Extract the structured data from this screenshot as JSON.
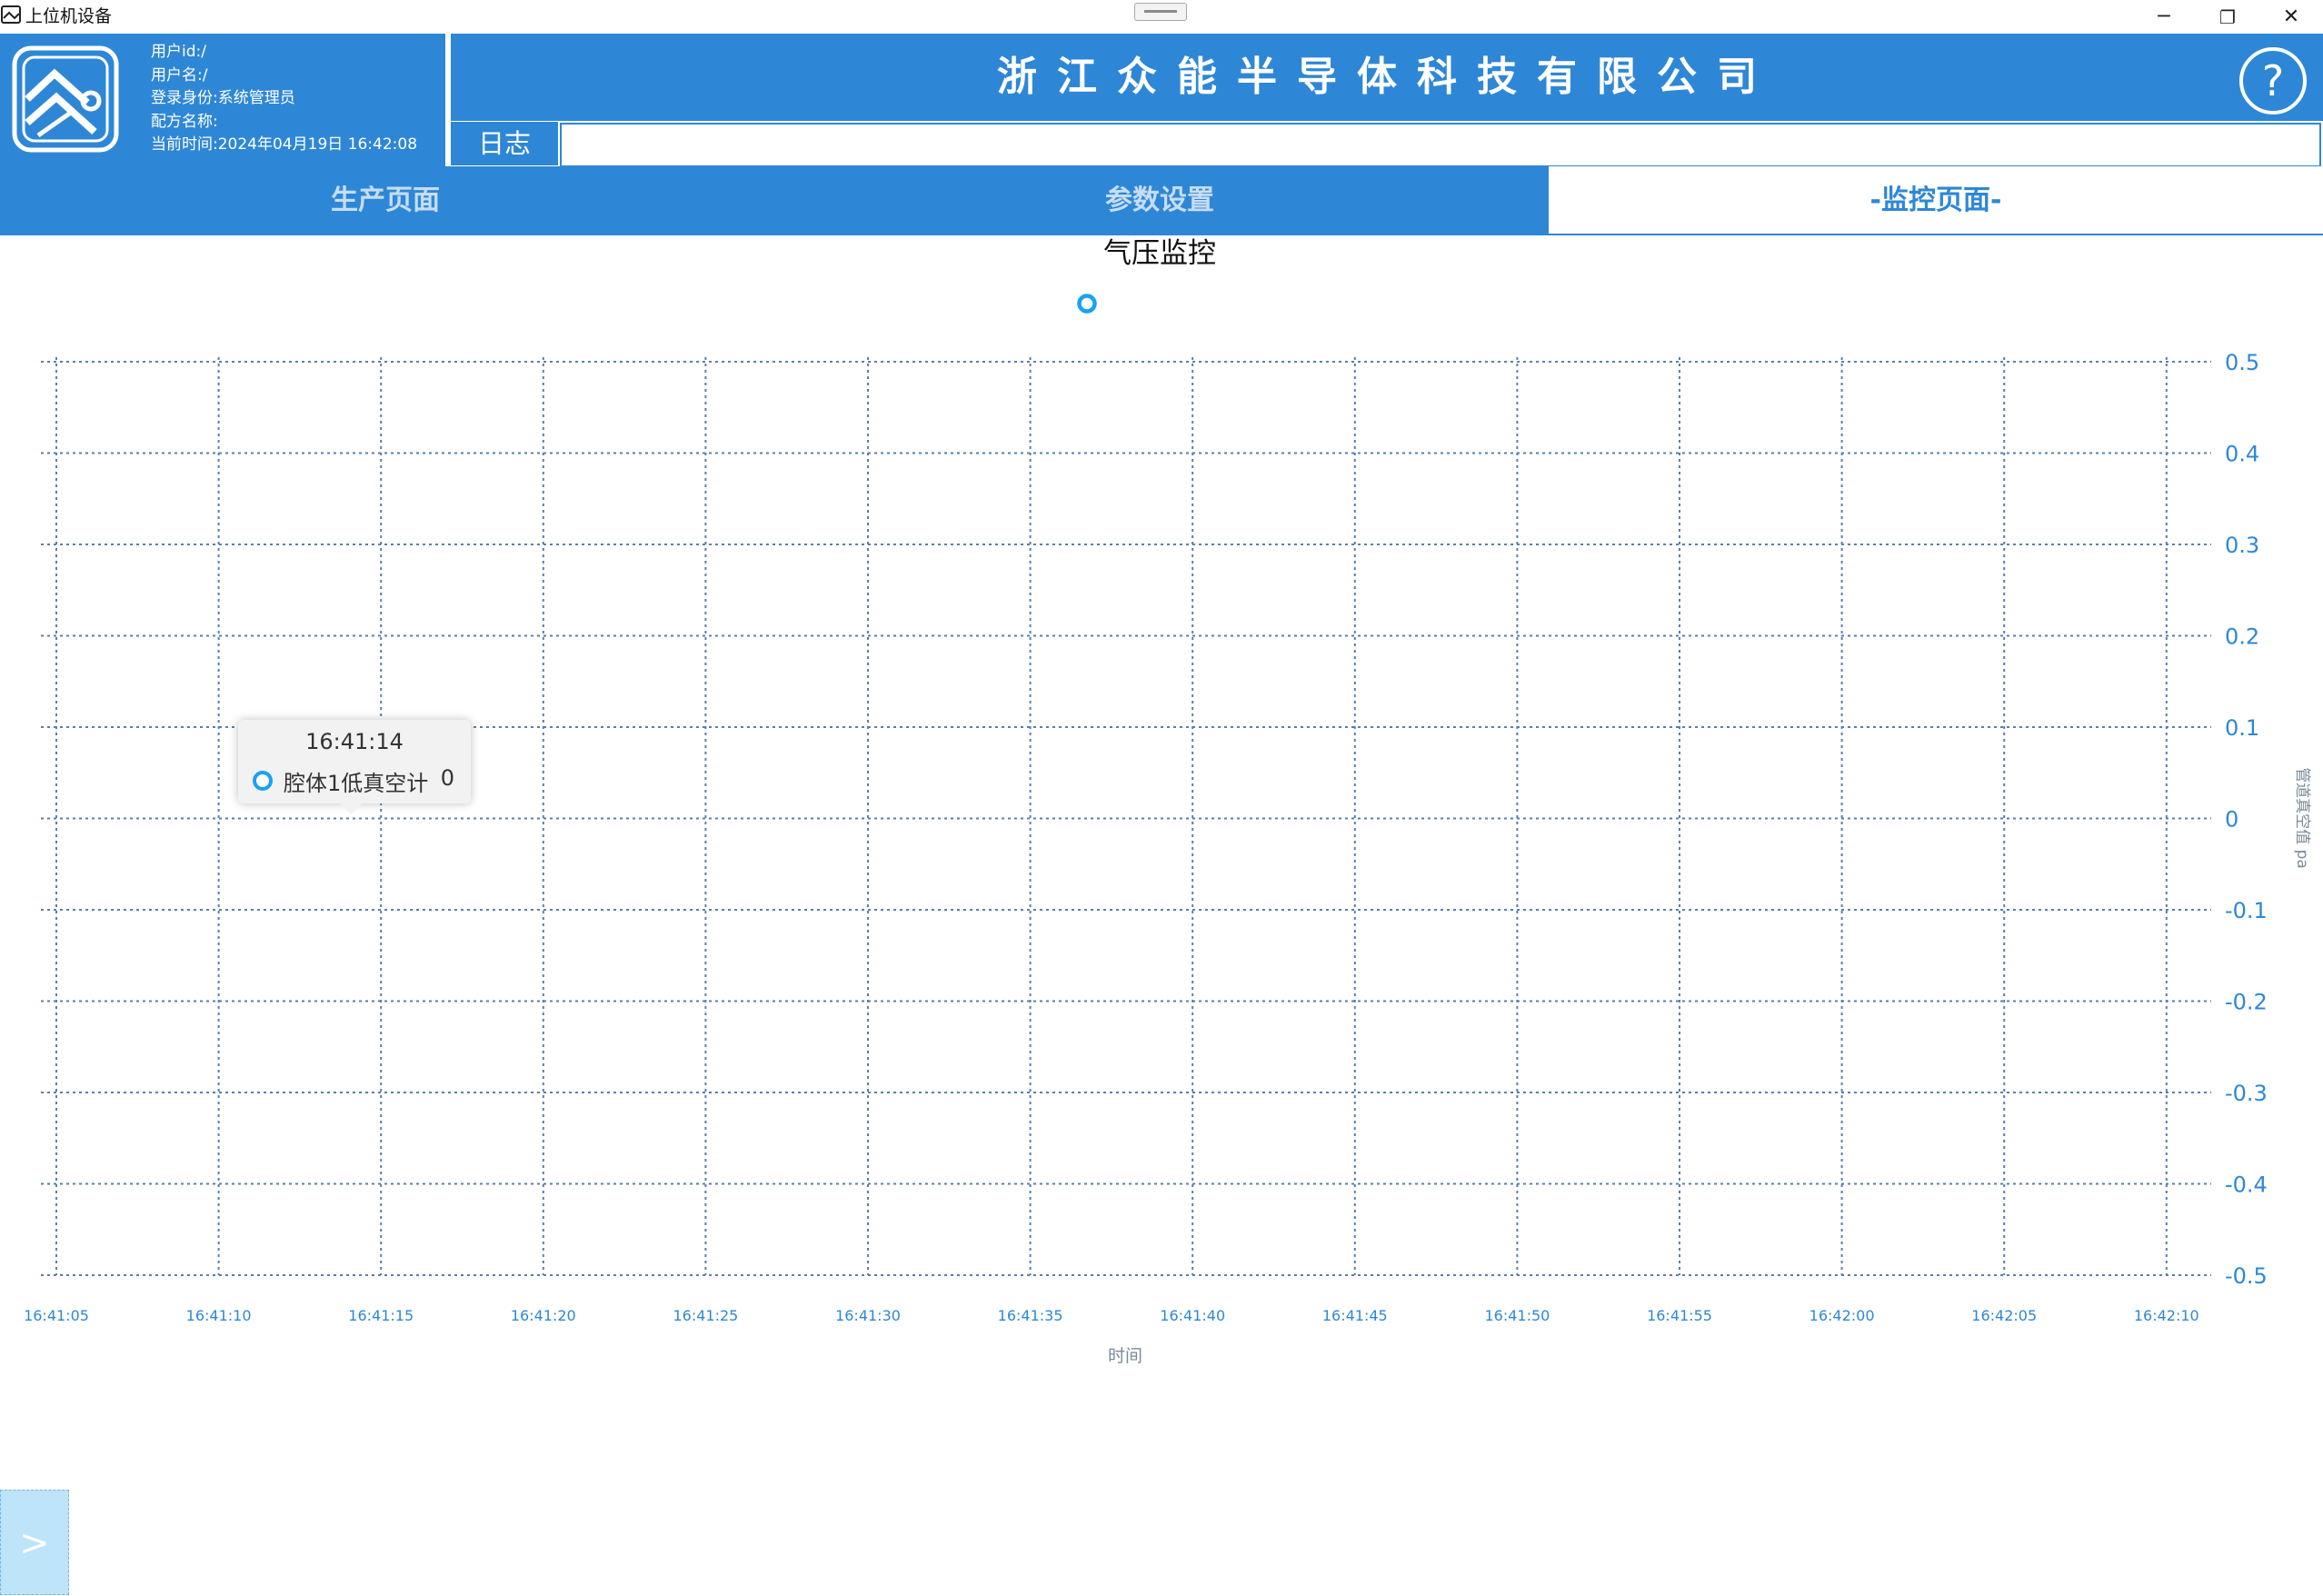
{
  "window": {
    "title": "上位机设备",
    "minimize_glyph": "─",
    "restore_glyph": "❐",
    "close_glyph": "✕"
  },
  "header": {
    "user_id": "用户id:/",
    "user_name": "用户名:/",
    "login_role": "登录身份:系统管理员",
    "recipe_name": "配方名称:",
    "current_time": "当前时间:2024年04月19日 16:42:08",
    "company_name": "浙江众能半导体科技有限公司",
    "help_label": "?",
    "log_label": "日志",
    "log_value": ""
  },
  "tabs": [
    {
      "label": "生产页面",
      "active": false
    },
    {
      "label": "参数设置",
      "active": false
    },
    {
      "label": "-监控页面-",
      "active": true
    }
  ],
  "colors": {
    "brand": "#2e87d6",
    "series": "#1aa1f5",
    "axis_text": "#2e87d6",
    "grid": "#5a7fa8"
  },
  "chart_data": {
    "type": "line",
    "title": "气压监控",
    "xlabel": "时间",
    "ylabel": "管道真空值 pa",
    "x_ticks": [
      "16:41:05",
      "16:41:10",
      "16:41:15",
      "16:41:20",
      "16:41:25",
      "16:41:30",
      "16:41:35",
      "16:41:40",
      "16:41:45",
      "16:41:50",
      "16:41:55",
      "16:42:00",
      "16:42:05",
      "16:42:10"
    ],
    "y_ticks": [
      "0.5",
      "0.4",
      "0.3",
      "0.2",
      "0.1",
      "0",
      "-0.1",
      "-0.2",
      "-0.3",
      "-0.4",
      "-0.5"
    ],
    "ylim": [
      -0.5,
      0.5
    ],
    "y_axis_position": "right",
    "grid": true,
    "legend_position": "top",
    "series": [
      {
        "name": "腔体1低真空计",
        "values": [
          0
        ]
      }
    ],
    "tooltip": {
      "time": "16:41:14",
      "series": "腔体1低真空计",
      "value": "0"
    }
  },
  "controls": {
    "expand_label": ">"
  }
}
